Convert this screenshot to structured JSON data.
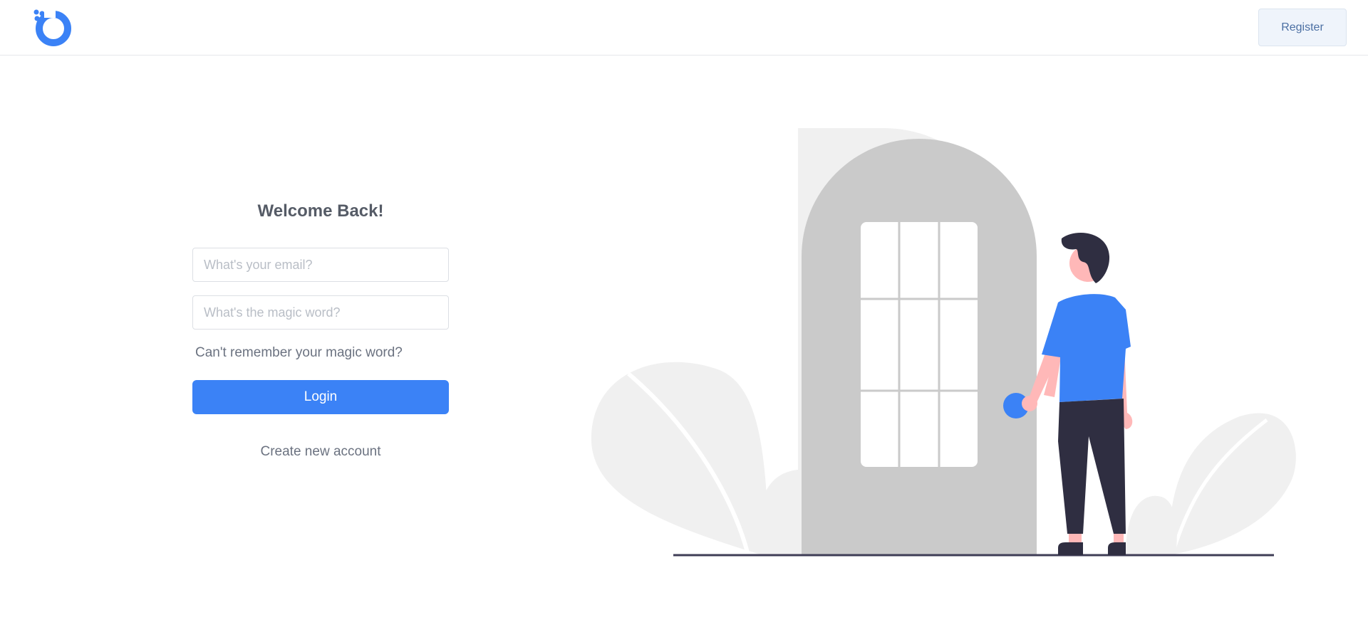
{
  "header": {
    "logo_icon": "brand-logo-icon",
    "register_label": "Register"
  },
  "login": {
    "title": "Welcome Back!",
    "email_placeholder": "What's your email?",
    "password_placeholder": "What's the magic word?",
    "forgot_label": "Can't remember your magic word?",
    "login_label": "Login",
    "create_label": "Create new account"
  },
  "colors": {
    "accent": "#3b82f6",
    "text_muted": "#6b7280",
    "figure_pants": "#2f2e41",
    "door": "#cacaca",
    "plant": "#f2f2f2"
  }
}
